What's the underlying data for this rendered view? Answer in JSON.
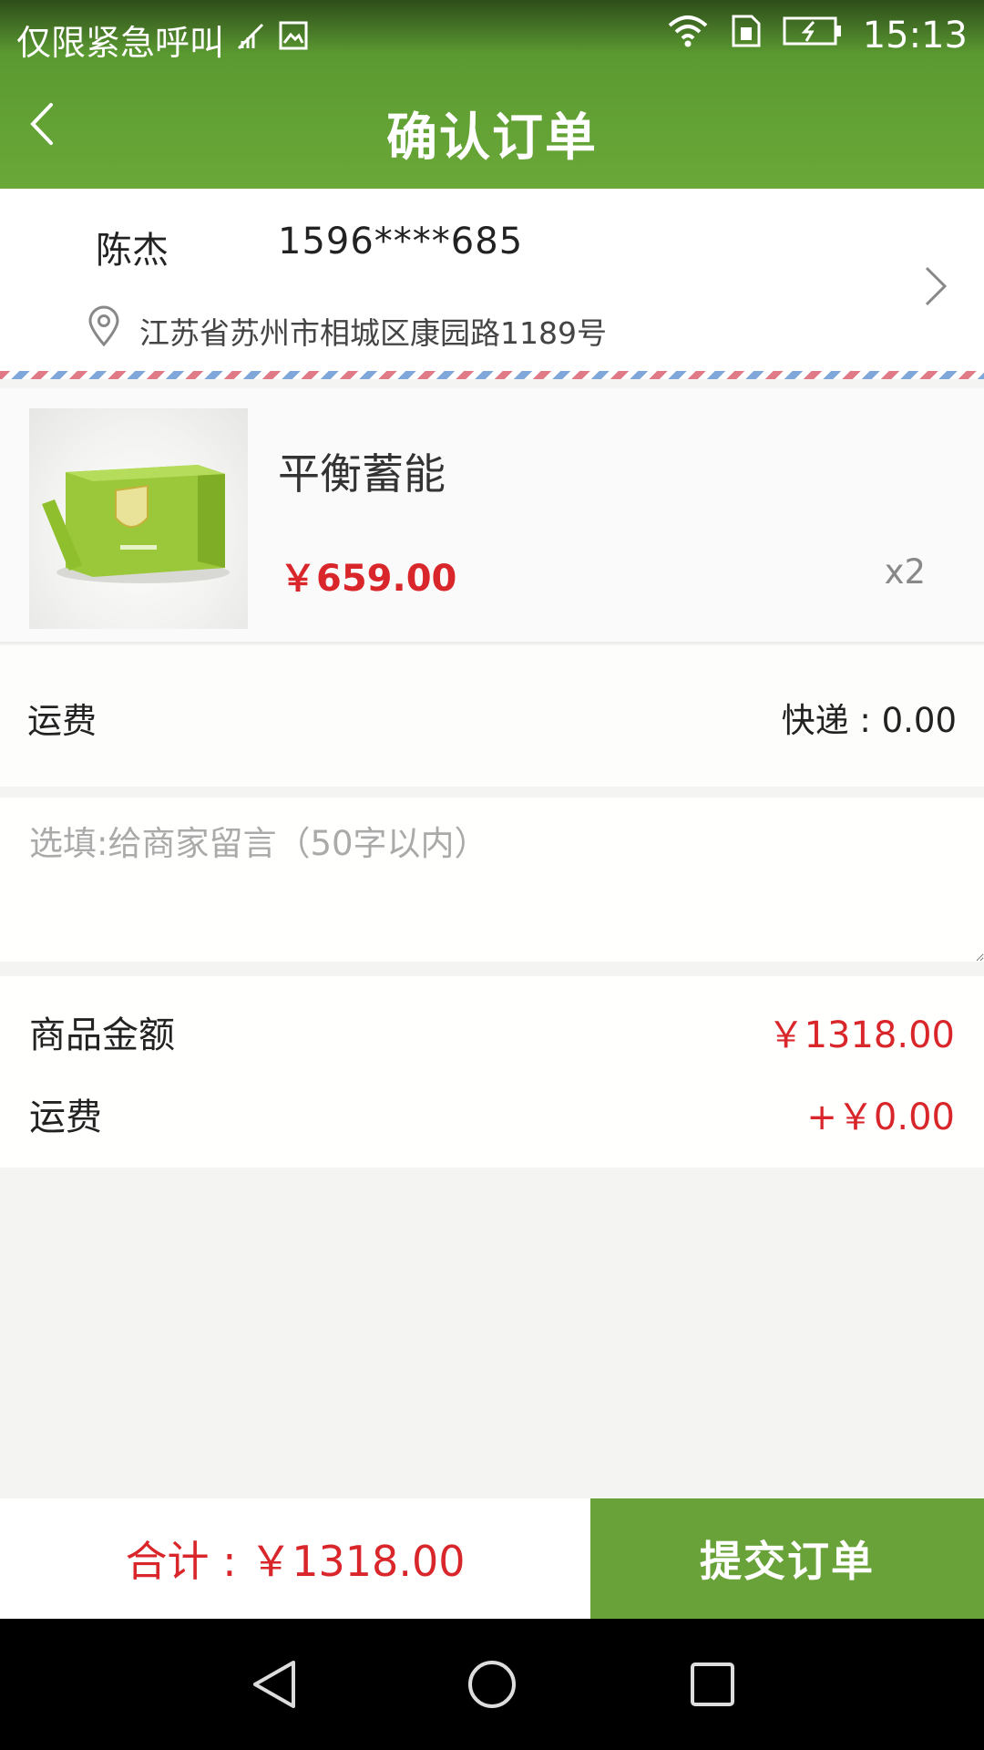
{
  "status_bar": {
    "carrier": "仅限紧急呼叫",
    "time": "15:13"
  },
  "header": {
    "title": "确认订单"
  },
  "address": {
    "name": "陈杰",
    "phone": "1596****685",
    "address": "江苏省苏州市相城区康园路1189号"
  },
  "product": {
    "name": "平衡蓄能",
    "price": "￥659.00",
    "quantity": "x2"
  },
  "shipping": {
    "label": "运费",
    "value": "快递 : 0.00"
  },
  "message": {
    "placeholder": "选填:给商家留言（50字以内）",
    "value": ""
  },
  "summary": {
    "goods_label": "商品金额",
    "goods_value": "￥1318.00",
    "freight_label": "运费",
    "freight_value": "+￥0.00"
  },
  "bottom": {
    "total": "合计 : ￥1318.00",
    "submit": "提交订单"
  },
  "colors": {
    "brand_green": "#6aa23a",
    "price_red": "#d9262b"
  },
  "icons": [
    "back-icon",
    "location-pin-icon",
    "chevron-right-icon",
    "wifi-icon",
    "sim-icon",
    "battery-icon",
    "nav-back-icon",
    "nav-home-icon",
    "nav-recents-icon"
  ]
}
